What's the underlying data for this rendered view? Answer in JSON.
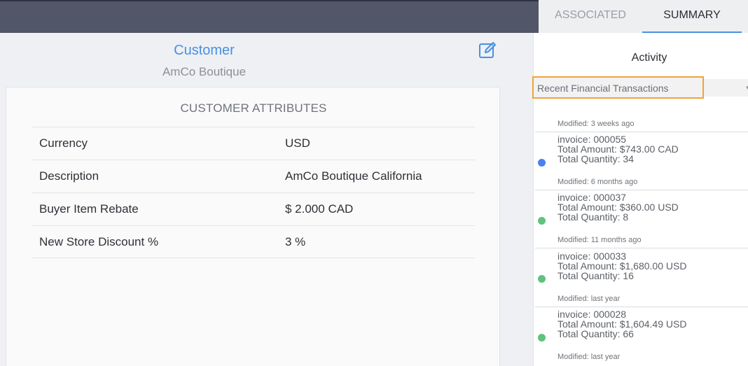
{
  "tabs": {
    "associated": "ASSOCIATED",
    "summary": "SUMMARY",
    "active": "summary"
  },
  "customer": {
    "title": "Customer",
    "name": "AmCo Boutique"
  },
  "attributes": {
    "heading": "CUSTOMER ATTRIBUTES",
    "rows": [
      {
        "label": "Currency",
        "value": "USD"
      },
      {
        "label": "Description",
        "value": "AmCo Boutique California"
      },
      {
        "label": "Buyer Item Rebate",
        "value": "$ 2.000 CAD"
      },
      {
        "label": "New Store Discount %",
        "value": "3 %"
      }
    ]
  },
  "activity": {
    "title": "Activity",
    "section": "Recent Financial Transactions",
    "first_modified": "Modified: 3 weeks  ago",
    "transactions": [
      {
        "invoice": "invoice: 000055",
        "amount": "Total Amount: $743.00 CAD",
        "quantity": "Total Quantity: 34",
        "modified": "Modified: 6 months  ago",
        "status_color": "#4a80f0"
      },
      {
        "invoice": "invoice: 000037",
        "amount": "Total Amount: $360.00 USD",
        "quantity": "Total Quantity: 8",
        "modified": "Modified: 11 months  ago",
        "status_color": "#5fc27e"
      },
      {
        "invoice": "invoice: 000033",
        "amount": "Total Amount: $1,680.00 USD",
        "quantity": "Total Quantity: 16",
        "modified": "Modified: last year",
        "status_color": "#5fc27e"
      },
      {
        "invoice": "invoice: 000028",
        "amount": "Total Amount: $1,604.49 USD",
        "quantity": "Total Quantity: 66",
        "modified": "Modified: last year",
        "status_color": "#5fc27e"
      }
    ]
  },
  "colors": {
    "accent": "#4a90e2",
    "highlight": "#f0a33a",
    "topbar": "#525669"
  }
}
